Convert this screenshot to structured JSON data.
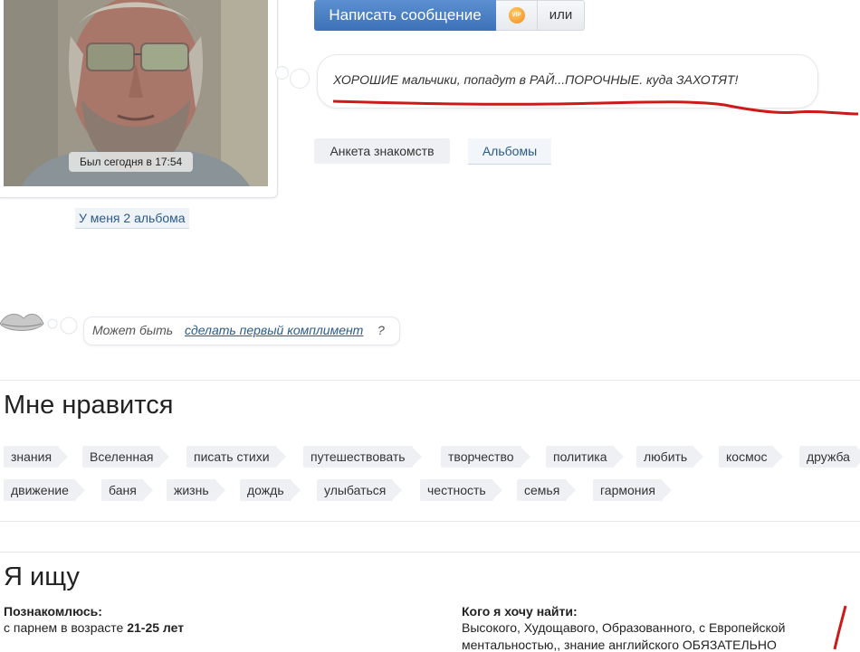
{
  "profile": {
    "last_seen": "Был сегодня в 17:54",
    "albums_count_link": "У меня 2 альбома"
  },
  "actions": {
    "send_message": "Написать сообщение",
    "vip_icon": "vip-icon",
    "or_label": "или"
  },
  "status": {
    "text": "ХОРОШИЕ мальчики, попадут в РАЙ...ПОРОЧНЫЕ. куда ЗАХОТЯТ!"
  },
  "tabs": {
    "profile": "Анкета знакомств",
    "albums": "Альбомы"
  },
  "compliment": {
    "prefix": "Может быть",
    "link": "сделать первый комплимент",
    "suffix": "?"
  },
  "likes": {
    "heading": "Мне нравится",
    "tags": [
      "знания",
      "Вселенная",
      "писать стихи",
      "путешествовать",
      "творчество",
      "политика",
      "любить",
      "космос",
      "дружба",
      "движение",
      "баня",
      "жизнь",
      "дождь",
      "улыбаться",
      "честность",
      "семья",
      "гармония"
    ]
  },
  "looking": {
    "heading": "Я ищу",
    "meet_label": "Познакомлюсь:",
    "meet_prefix": "с парнем в возрасте",
    "meet_age": "21-25 лет",
    "whom_label": "Кого я хочу найти:",
    "whom_line1": "Высокого, Худощавого, Образованного, с Европейской",
    "whom_line2": "ментальностью,, знание английского ОБЯЗАТЕЛЬНО"
  }
}
